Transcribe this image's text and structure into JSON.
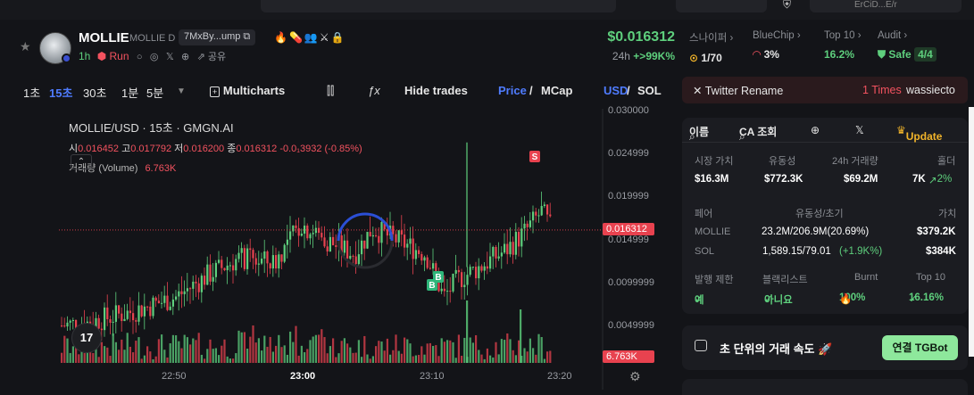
{
  "topbar": {
    "account_label": "ErCiD...E/r"
  },
  "token": {
    "symbol": "MOLLIE",
    "fullname": "MOLLIE D",
    "address": "7MxBy...ump",
    "flag_icons": "🔥💊👥⚔🔒",
    "age": "1h",
    "run_label": "Run",
    "share_label": "공유",
    "price": "$0.016312",
    "change_period": "24h",
    "change_value": "+>99K%"
  },
  "stats": [
    {
      "label": "스나이퍼",
      "value": "1/70",
      "color": "#e6e6e6"
    },
    {
      "label": "BlueChip",
      "value": "3%",
      "color": "#e6e6e6"
    },
    {
      "label": "Top 10",
      "value": "16.2%",
      "color": "#5ecf7d"
    },
    {
      "label": "Audit",
      "value": "Safe",
      "badge": "4/4",
      "color": "#5ecf7d"
    }
  ],
  "toolbar": {
    "intervals": [
      "1초",
      "15초",
      "30초",
      "1분",
      "5분"
    ],
    "active_interval": "15초",
    "multicharts": "Multicharts",
    "hide_trades": "Hide trades",
    "price": "Price",
    "mcap": "MCap",
    "usd": "USD",
    "sol": "SOL"
  },
  "legend": {
    "title": "MOLLIE/USD · 15초 · GMGN.AI",
    "open_label": "시",
    "open": "0.016452",
    "high_label": "고",
    "high": "0.017792",
    "low_label": "저",
    "low": "0.016200",
    "close_label": "종",
    "close": "0.016312",
    "delta": "-0.0₁3932 (-0.85%)",
    "volume_label": "거래량 (Volume)",
    "volume": "6.763K"
  },
  "chart_data": {
    "type": "candlestick",
    "y_ticks": [
      "0.030000",
      "0.024999",
      "0.019999",
      "0.014999",
      "0.0099999",
      "0.0049999"
    ],
    "x_ticks": [
      "22:50",
      "23:00",
      "23:10",
      "23:20"
    ],
    "last_price": "0.016312",
    "last_volume": "6.763K",
    "ylim": [
      0,
      0.03
    ],
    "markers": [
      {
        "label": "S",
        "color": "#e8424f"
      },
      {
        "label": "B",
        "color": "#2fb67a"
      },
      {
        "label": "B",
        "color": "#2fb67a"
      }
    ],
    "up_color": "#5ecf7d",
    "down_color": "#e8424f"
  },
  "twitter": {
    "label": "Twitter Rename",
    "times": "1 Times",
    "who": "wassiecto"
  },
  "card": {
    "search_name": "이름",
    "search_ca": "CA 조회",
    "update": "Update",
    "headers1": [
      "시장 가치",
      "유동성",
      "24h 거래량",
      "홀더"
    ],
    "values1": [
      "$16.3M",
      "$772.3K",
      "$69.2M",
      "7K"
    ],
    "holder_change": "2%",
    "pair_header": "페어",
    "liq_header": "유동성/초기",
    "value_header": "가치",
    "pairs": [
      {
        "name": "MOLLIE",
        "liq": "23.2M/206.9M(20.69%)",
        "value": "$379.2K"
      },
      {
        "name": "SOL",
        "liq": "1,589.15/79.01",
        "liq_change": "(+1.9K%)",
        "value": "$384K"
      }
    ],
    "headers3": [
      "발행 제한",
      "블랙리스트",
      "Burnt",
      "Top 10"
    ],
    "values3": [
      "예",
      "아니요",
      "100%",
      "16.16%"
    ]
  },
  "speed": {
    "title": "초 단위의 거래 속도 🚀",
    "button": "연결 TGBot"
  }
}
